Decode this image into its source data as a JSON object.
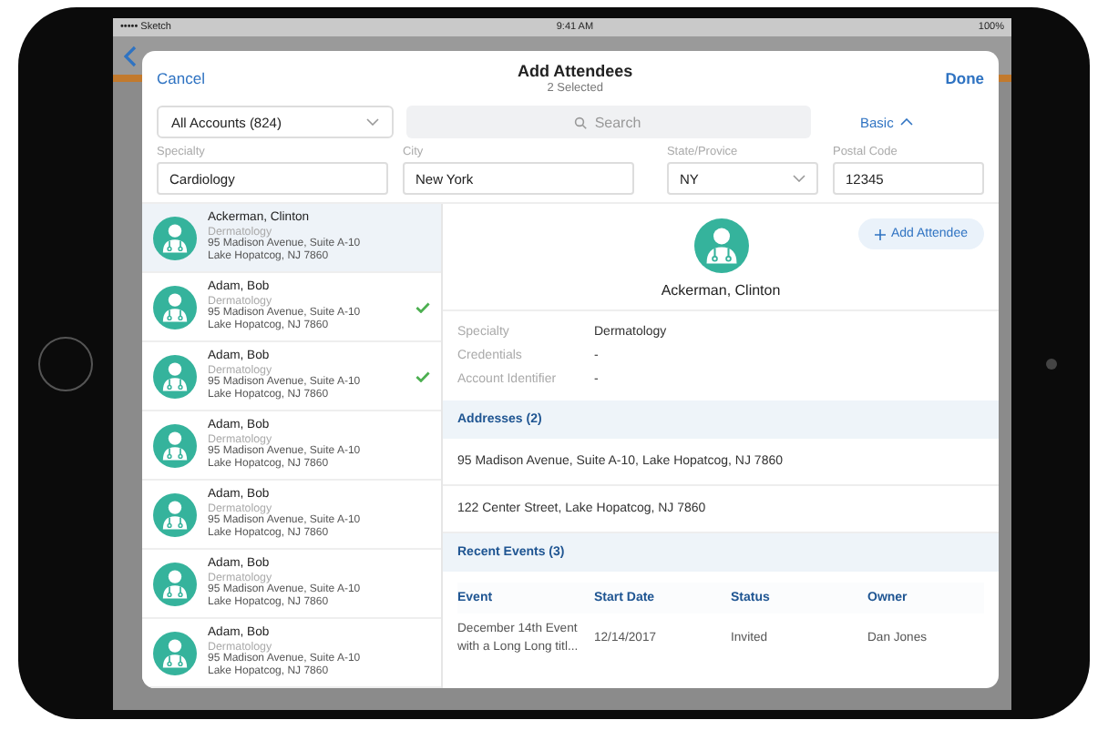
{
  "status_bar": {
    "carrier": "••••• Sketch",
    "time": "9:41 AM",
    "battery": "100%"
  },
  "modal": {
    "cancel": "Cancel",
    "title": "Add Attendees",
    "subtitle": "2 Selected",
    "done": "Done"
  },
  "filters": {
    "account_select": "All Accounts (824)",
    "search": {
      "placeholder": "Search"
    },
    "mode_toggle": "Basic",
    "fields": [
      {
        "label": "Specialty",
        "value": "Cardiology",
        "kind": "text"
      },
      {
        "label": "City",
        "value": "New York",
        "kind": "text"
      },
      {
        "label": "State/Provice",
        "value": "NY",
        "kind": "select"
      },
      {
        "label": "Postal Code",
        "value": "12345",
        "kind": "text"
      }
    ]
  },
  "contacts": [
    {
      "name": "Ackerman, Clinton",
      "specialty": "Dermatology",
      "address_1": "95 Madison Avenue, Suite A-10",
      "address_2": "Lake Hopatcog, NJ 7860",
      "selected": true,
      "checked": false
    },
    {
      "name": "Adam, Bob",
      "specialty": "Dermatology",
      "address_1": "95 Madison Avenue, Suite A-10",
      "address_2": "Lake Hopatcog, NJ 7860",
      "selected": false,
      "checked": true
    },
    {
      "name": "Adam, Bob",
      "specialty": "Dermatology",
      "address_1": "95 Madison Avenue, Suite A-10",
      "address_2": "Lake Hopatcog, NJ 7860",
      "selected": false,
      "checked": true
    },
    {
      "name": "Adam, Bob",
      "specialty": "Dermatology",
      "address_1": "95 Madison Avenue, Suite A-10",
      "address_2": "Lake Hopatcog, NJ 7860",
      "selected": false,
      "checked": false
    },
    {
      "name": "Adam, Bob",
      "specialty": "Dermatology",
      "address_1": "95 Madison Avenue, Suite A-10",
      "address_2": "Lake Hopatcog, NJ 7860",
      "selected": false,
      "checked": false
    },
    {
      "name": "Adam, Bob",
      "specialty": "Dermatology",
      "address_1": "95 Madison Avenue, Suite A-10",
      "address_2": "Lake Hopatcog, NJ 7860",
      "selected": false,
      "checked": false
    },
    {
      "name": "Adam, Bob",
      "specialty": "Dermatology",
      "address_1": "95 Madison Avenue, Suite A-10",
      "address_2": "Lake Hopatcog, NJ 7860",
      "selected": false,
      "checked": false
    }
  ],
  "detail": {
    "add_button": "Add Attendee",
    "name": "Ackerman, Clinton",
    "info": [
      {
        "label": "Specialty",
        "value": "Dermatology"
      },
      {
        "label": "Credentials",
        "value": "-"
      },
      {
        "label": "Account Identifier",
        "value": "-"
      }
    ],
    "addresses": {
      "title": "Addresses (2)",
      "items": [
        "95 Madison Avenue, Suite A-10, Lake Hopatcog, NJ 7860",
        "122 Center Street, Lake Hopatcog, NJ 7860"
      ]
    },
    "events": {
      "title": "Recent Events (3)",
      "columns": [
        "Event",
        "Start Date",
        "Status",
        "Owner"
      ],
      "rows": [
        [
          "December 14th Event with a Long Long titl...",
          "12/14/2017",
          "Invited",
          "Dan Jones"
        ]
      ]
    }
  }
}
